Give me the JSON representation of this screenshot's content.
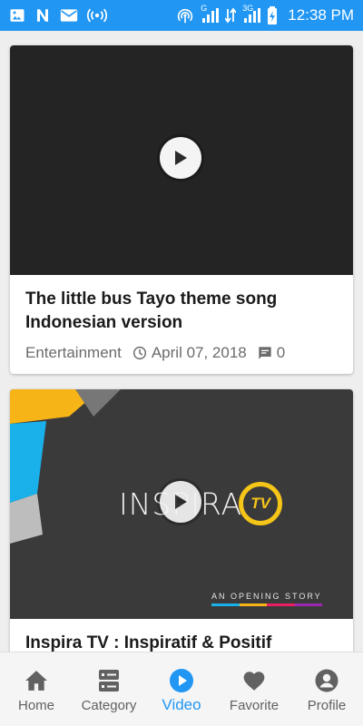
{
  "status_bar": {
    "time": "12:38 PM",
    "network_label": "3G",
    "sim_label": "G",
    "bg_color": "#2196f3"
  },
  "feed": {
    "items": [
      {
        "title": "The little bus Tayo theme song Indonesian version",
        "category": "Entertainment",
        "date": "April 07, 2018",
        "comments": "0",
        "thumbnail": "dark-video-placeholder"
      },
      {
        "title": "Inspira TV : Inspiratif & Positif",
        "thumbnail_brand": "INSPIRA",
        "thumbnail_logo": "TV",
        "thumbnail_tagline": "AN OPENING STORY"
      }
    ]
  },
  "bottom_nav": {
    "items": [
      {
        "label": "Home",
        "icon": "home-icon"
      },
      {
        "label": "Category",
        "icon": "category-icon"
      },
      {
        "label": "Video",
        "icon": "play-circle-icon",
        "active": true
      },
      {
        "label": "Favorite",
        "icon": "heart-icon"
      },
      {
        "label": "Profile",
        "icon": "profile-icon"
      }
    ],
    "active_color": "#2196f3",
    "inactive_color": "#616161"
  }
}
